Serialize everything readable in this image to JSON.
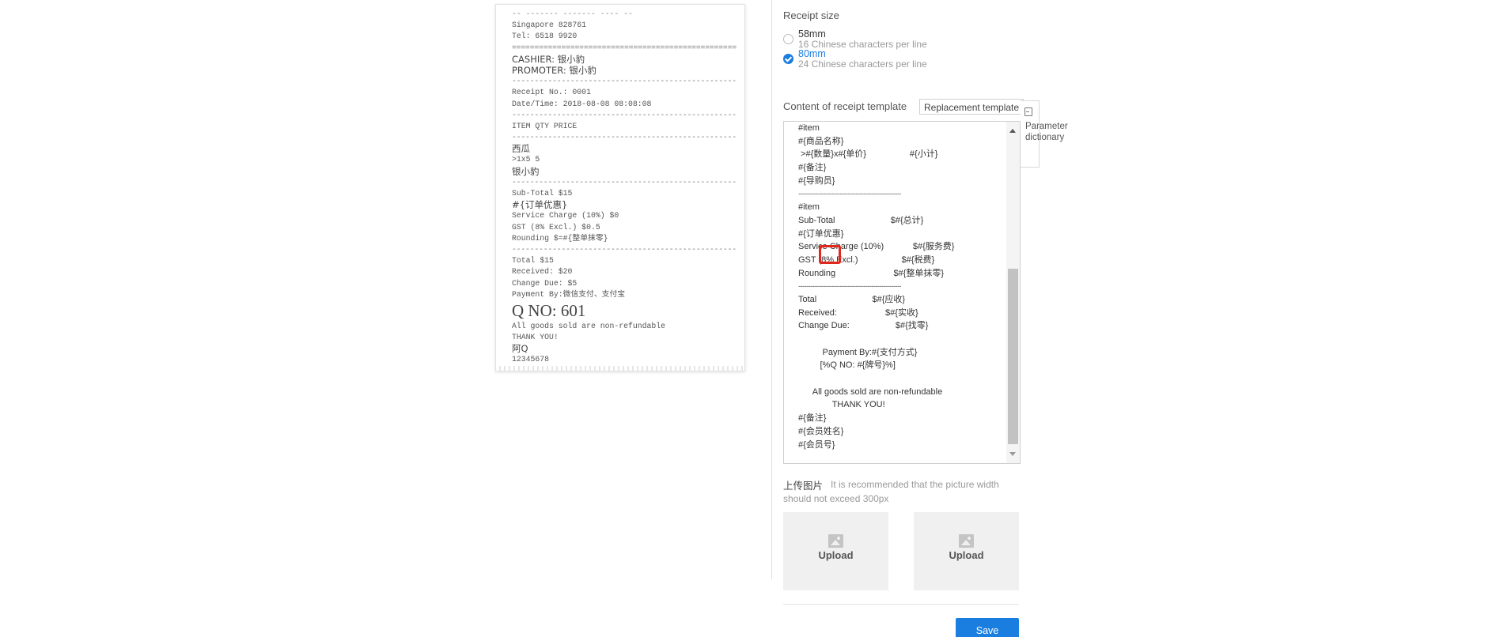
{
  "receipt_preview": {
    "top_partial": "-- ------- ------- ---- --",
    "address": "Singapore 828761",
    "tel": "Tel: 6518 9920",
    "rule_double": "==================================================",
    "cashier": "CASHIER: 银小豹",
    "promoter": "PROMOTER: 银小豹",
    "rule_single": "--------------------------------------------------",
    "receipt_no": "Receipt No.: 0001",
    "datetime": "Date/Time: 2018-08-08 08:08:08",
    "header_cols": "ITEM QTY PRICE",
    "item_name": "西瓜",
    "item_line": ">1x5 5",
    "item_guide": "银小豹",
    "subtotal": "Sub-Total $15",
    "order_discount": "#{订单优惠}",
    "service_charge": "Service Charge (10%) $0",
    "gst": "GST (8% Excl.) $0.5",
    "rounding": "Rounding $=#{整单抹零}",
    "total": "Total $15",
    "received": "Received: $20",
    "change_due": "Change Due: $5",
    "payment_by": "Payment By:微信支付、支付宝",
    "q_no": "Q NO: 601",
    "non_refundable": "All goods sold are non-refundable",
    "thank_you": "THANK YOU!",
    "member_name": "阿Q",
    "member_no": "12345678"
  },
  "receipt_size": {
    "label": "Receipt size",
    "options": [
      {
        "value": "58mm",
        "desc": "16 Chinese characters per line",
        "selected": false
      },
      {
        "value": "80mm",
        "desc": "24 Chinese characters per line",
        "selected": true
      }
    ]
  },
  "template": {
    "label": "Content of receipt template",
    "replace_button": "Replacement template",
    "param_dictionary": "Parameter dictionary",
    "lines": [
      "#item",
      "#{商品名称}",
      " >#{数量}x#{单价}                  #{小计}",
      "#{备注}",
      "#{导购员}",
      "----------------------------------------------------",
      "#item",
      "Sub-Total                       $#{总计}",
      "#{订单优惠}",
      "Service Charge (10%)            $#{服务费}",
      "GST (8% Excl.)                  $#{税费}",
      "Rounding                        $#{整单抹零}",
      "----------------------------------------------------",
      "Total                       $#{应收}",
      "Received:                    $#{实收}",
      "Change Due:                   $#{找零}",
      "",
      "          Payment By:#{支付方式}",
      "         [%Q NO: #{牌号}%]",
      "",
      "      All goods sold are non-refundable",
      "              THANK YOU!",
      "#{备注}",
      "#{会员姓名}",
      "#{会员号}"
    ]
  },
  "upload": {
    "label": "上传图片",
    "hint_line1": "It is recommended that the picture width",
    "hint_line2": "should not exceed 300px",
    "tiles": [
      "Upload",
      "Upload"
    ]
  },
  "actions": {
    "save": "Save"
  },
  "colors": {
    "accent": "#1a7ee0",
    "highlight": "#e0281e"
  }
}
